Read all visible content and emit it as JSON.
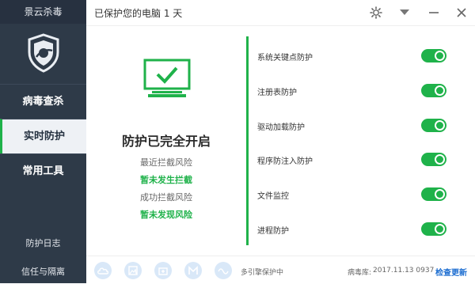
{
  "app": {
    "brand": "景云杀毒"
  },
  "titlebar": {
    "title": "已保护您的电脑  1  天"
  },
  "sidebar": {
    "nav": [
      {
        "label": "病毒查杀",
        "active": false
      },
      {
        "label": "实时防护",
        "active": true
      },
      {
        "label": "常用工具",
        "active": false
      }
    ],
    "bottom": [
      {
        "label": "防护日志"
      },
      {
        "label": "信任与隔离"
      }
    ]
  },
  "center": {
    "status_title": "防护已完全开启",
    "stats": [
      {
        "text": "最近拦截风险",
        "style": "grey"
      },
      {
        "text": "暂未发生拦截",
        "style": "green"
      },
      {
        "text": "成功拦截风险",
        "style": "grey"
      },
      {
        "text": "暂未发现风险",
        "style": "green"
      }
    ]
  },
  "protections": [
    {
      "label": "系统关键点防护",
      "on": true
    },
    {
      "label": "注册表防护",
      "on": true
    },
    {
      "label": "驱动加载防护",
      "on": true
    },
    {
      "label": "程序防注入防护",
      "on": true
    },
    {
      "label": "文件监控",
      "on": true
    },
    {
      "label": "进程防护",
      "on": true
    }
  ],
  "bottombar": {
    "icons": [
      "cloud-icon",
      "image-icon",
      "medkit-icon",
      "mail-icon",
      "wave-icon"
    ],
    "protect_text": "多引擎保护中",
    "db_label": "病毒库:",
    "db_version": "2017.11.13 0937",
    "update_label": "检查更新"
  },
  "colors": {
    "accent": "#1fb24a",
    "sidebar": "#2e3a48",
    "link": "#1f6fd1"
  }
}
